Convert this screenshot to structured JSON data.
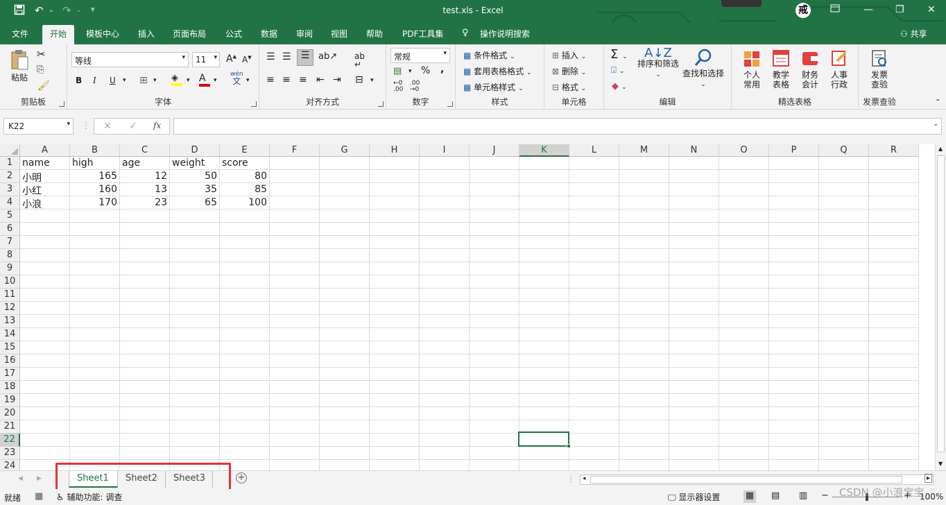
{
  "window": {
    "title": "test.xls  -  Excel",
    "qat_more": "⩔"
  },
  "ribbon_tabs": [
    "文件",
    "开始",
    "模板中心",
    "插入",
    "页面布局",
    "公式",
    "数据",
    "审阅",
    "视图",
    "帮助",
    "PDF工具集",
    "操作说明搜索"
  ],
  "share_label": "共享",
  "groups": {
    "clipboard": {
      "label": "剪贴板",
      "paste": "粘贴"
    },
    "font": {
      "label": "字体",
      "name": "等线",
      "size": "11",
      "bold": "B",
      "italic": "I",
      "underline": "U",
      "grow": "A",
      "shrink": "A",
      "phonetic_top": "wén",
      "phonetic": "文"
    },
    "align": {
      "label": "对齐方式"
    },
    "number": {
      "label": "数字",
      "format": "常规",
      "percent": "%",
      "comma": ","
    },
    "styles": {
      "label": "样式",
      "cond": "条件格式",
      "table": "套用表格格式",
      "cell": "单元格样式"
    },
    "cells": {
      "label": "单元格",
      "insert": "插入",
      "delete": "删除",
      "format": "格式"
    },
    "edit": {
      "label": "编辑",
      "sort": "排序和筛选",
      "find": "查找和选择"
    },
    "templates": {
      "label": "精选表格",
      "items": [
        "个人\n常用",
        "教学\n表格",
        "财务\n会计",
        "人事\n行政"
      ]
    },
    "invoice": {
      "label": "发票查验",
      "item": "发票\n查验"
    }
  },
  "formula_bar": {
    "name_box": "K22",
    "fx": "fx",
    "value": ""
  },
  "columns": [
    "A",
    "B",
    "C",
    "D",
    "E",
    "F",
    "G",
    "H",
    "I",
    "J",
    "K",
    "L",
    "M",
    "N",
    "O",
    "P",
    "Q",
    "R"
  ],
  "selected_column": "K",
  "selected_row": 22,
  "rows": [
    "1",
    "2",
    "3",
    "4",
    "5",
    "6",
    "7",
    "8",
    "9",
    "10",
    "11",
    "12",
    "13",
    "14",
    "15",
    "16",
    "17",
    "18",
    "19",
    "20",
    "21",
    "22",
    "23",
    "24"
  ],
  "cells": [
    [
      "name",
      "high",
      "age",
      "weight",
      "score"
    ],
    [
      "小明",
      "165",
      "12",
      "50",
      "80"
    ],
    [
      "小红",
      "160",
      "13",
      "35",
      "85"
    ],
    [
      "小浪",
      "170",
      "23",
      "65",
      "100"
    ]
  ],
  "sheets": [
    "Sheet1",
    "Sheet2",
    "Sheet3"
  ],
  "active_sheet": "Sheet1",
  "status": {
    "ready": "就绪",
    "accessibility": "辅助功能: 调查",
    "display": "显示器设置",
    "zoom": "100%"
  },
  "watermark": "CSDN @小浪宝宝",
  "colors": {
    "excel_green": "#217346",
    "highlight_box": "#e53333",
    "font_color_bar": "#e00000",
    "fill_color_bar": "#ffff00"
  }
}
